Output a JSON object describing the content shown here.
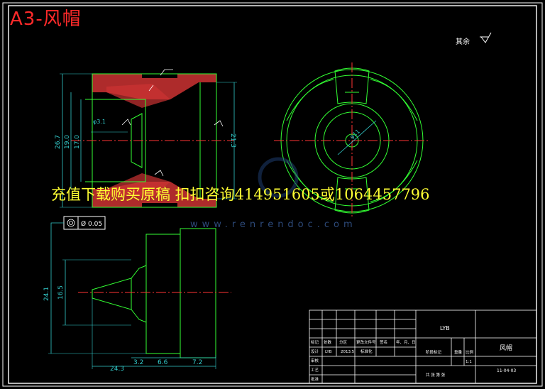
{
  "drawing": {
    "title": "A3-风帽",
    "surface_note": "其余",
    "watermark_text": "充值下载购买原稿 扣扣咨询414951605或1064457796",
    "watermark_url": "www.renrendoc.com"
  },
  "dimensions": {
    "d_26_7": "26.7",
    "d_19_0": "19.0",
    "d_17_0": "17.0",
    "d_3_1": "φ3.1",
    "d_21_3": "21.3",
    "d_24_1": "24.1",
    "d_16_5": "16.5",
    "d_24_3": "24.3",
    "d_3_2": "3.2",
    "d_6_6": "6.6",
    "d_7_2": "7.2",
    "tolerance": "0.05",
    "d_phi11": "φ11"
  },
  "title_block": {
    "designer": "LYB",
    "part_name": "风帽",
    "drawing_no": "11-04-03",
    "r1": "标记",
    "r2": "处数",
    "r3": "分区",
    "r4": "更改文件号",
    "r5": "签名",
    "r6": "年、月、日",
    "c1": "设计",
    "c2": "LYB",
    "c3": "2013.5",
    "c4": "标准化",
    "c5": "审核",
    "c6": "工艺",
    "c7": "批准",
    "stage": "阶段标记",
    "weight": "重量",
    "scale": "比例",
    "scale_val": "1:1",
    "sheet": "共 张 第 张"
  },
  "colors": {
    "background": "#000000",
    "outline": "#33ff33",
    "dimension": "#33cccc",
    "center": "#ff3333",
    "hatch": "#cc3333",
    "title": "#ff2a2a",
    "watermark": "#ffff33",
    "frame": "#ffffff"
  }
}
